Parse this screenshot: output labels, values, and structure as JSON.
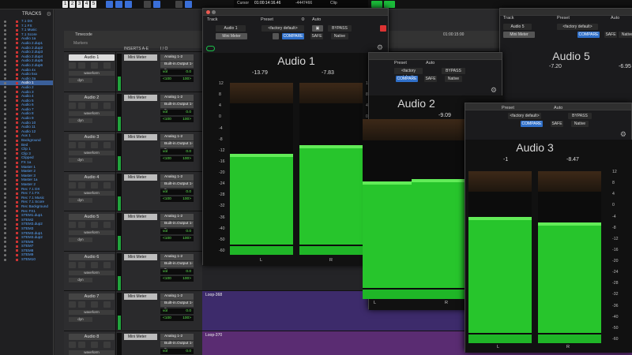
{
  "topbar": {
    "buttons": [
      "1",
      "2",
      "3",
      "4",
      "5"
    ],
    "counter": {
      "label": "Cursor",
      "time": "01:00:14:16.46",
      "sample": "-4447466",
      "clip_label": "Clip"
    }
  },
  "tracks_panel": {
    "title": "TRACKS",
    "menu_icon": "gear-icon",
    "items": [
      "7.1 DX",
      "7.1 FX",
      "7.1 Music",
      "7.1 Score",
      "Audio 1a",
      "Audio 2.dup1",
      "Audio 2.dup2",
      "Audio 2.dup3",
      "Audio 2.dup4",
      "Audio 2.dup5",
      "Audio 2.dup6",
      "Audio 4x",
      "Audio 5xx",
      "Audio 3a",
      "Audio 1",
      "Audio 2",
      "Audio 3",
      "Audio 4",
      "Audio 5",
      "Audio 6",
      "Audio 7",
      "Audio 8",
      "Audio 9",
      "Audio 10",
      "Audio 11",
      "Audio 12",
      "Aux 1",
      "Background",
      "Bed",
      "Clip 1",
      "Clip 3",
      "Clipped",
      "FX 1a",
      "Master 1",
      "Master 2",
      "Master 3",
      "Master 1a",
      "Master 2",
      "Rec 7.1 DX",
      "Rec 7.1 FX",
      "Rec 7.1 Music",
      "Rec 7.1 Score",
      "Rec Background",
      "Rec FX1",
      "STEM1.dup1",
      "STEM2",
      "STEM3.dup2",
      "STEM3",
      "STEM3.dup1",
      "STEM3.dup2",
      "STEM6",
      "STEM7",
      "STEM8",
      "STEM9",
      "STEM10"
    ],
    "selected": 14
  },
  "edit": {
    "ruler_label": "Timecode",
    "ruler_marker": "Markers",
    "ruler_time": "01:00:15:00",
    "columns": {
      "inserts": "INSERTS A-E",
      "io": "I / O"
    },
    "tracks": [
      {
        "name": "Audio 1",
        "insert": "Mini Meter",
        "input": "Analog 1-2",
        "output": "Built-in.Output 1-2",
        "vol": "0.0",
        "pan": "<100",
        "pan2": "100>",
        "view": "waveform",
        "dyn": "dyn"
      },
      {
        "name": "Audio 2",
        "insert": "Mini Meter",
        "input": "Analog 1-2",
        "output": "Built-in.Output 1-2",
        "vol": "0.0",
        "pan": "<100",
        "pan2": "100>",
        "view": "waveform",
        "dyn": "dyn"
      },
      {
        "name": "Audio 3",
        "insert": "Mini Meter",
        "input": "Analog 1-2",
        "output": "Built-in.Output 1-2",
        "vol": "0.0",
        "pan": "<100",
        "pan2": "100>",
        "view": "waveform",
        "dyn": "dyn"
      },
      {
        "name": "Audio 4",
        "insert": "Mini Meter",
        "input": "Analog 1-2",
        "output": "Built-in.Output 1-2",
        "vol": "0.0",
        "pan": "<100",
        "pan2": "100>",
        "view": "waveform",
        "dyn": "dyn"
      },
      {
        "name": "Audio 5",
        "insert": "Mini Meter",
        "input": "Analog 1-2",
        "output": "Built-in.Output 1-2",
        "vol": "0.0",
        "pan": "<100",
        "pan2": "100>",
        "view": "waveform",
        "dyn": "dyn"
      },
      {
        "name": "Audio 6",
        "insert": "Mini Meter",
        "input": "Analog 1-2",
        "output": "Built-in.Output 1-2",
        "vol": "0.0",
        "pan": "<100",
        "pan2": "100>",
        "view": "waveform",
        "dyn": "dyn"
      },
      {
        "name": "Audio 7",
        "insert": "Mini Meter",
        "input": "Analog 1-2",
        "output": "Built-in.Output 1-2",
        "vol": "0.0",
        "pan": "<100",
        "pan2": "100>",
        "view": "waveform",
        "dyn": "dyn"
      },
      {
        "name": "Audio 8",
        "insert": "Mini Meter",
        "input": "Analog 1-2",
        "output": "Built-in.Output 1-2",
        "vol": "0.0",
        "pan": "<100",
        "pan2": "100>",
        "view": "waveform",
        "dyn": "dyn"
      }
    ],
    "clip_labels": [
      "Loop-368",
      "Loop-370"
    ]
  },
  "plugins": [
    {
      "title": "Audio 1",
      "track_label": "Track",
      "track": "Audio 1",
      "preset_label": "Preset",
      "preset": "<factory default>",
      "auto_label": "Auto",
      "insert": "Mini Meter",
      "compare": "COMPARE",
      "safe": "SAFE",
      "native": "Native",
      "bypass": "BYPASS",
      "peak_l": "-13.79",
      "peak_r": "-7.83",
      "ch_l": "L",
      "ch_r": "R",
      "level_l": 0.62,
      "level_r": 0.68,
      "scale": [
        "12",
        "8",
        "4",
        "0",
        "-4",
        "-8",
        "-12",
        "-16",
        "-20",
        "-24",
        "-28",
        "-32",
        "-36",
        "-40",
        "-50",
        "-60"
      ]
    },
    {
      "title": "Audio 5",
      "track_label": "Track",
      "track": "Audio 5",
      "preset_label": "Preset",
      "preset": "<factory default>",
      "auto_label": "Auto",
      "insert": "Mini Meter",
      "compare": "COMPARE",
      "safe": "SAFE",
      "native": "Native",
      "bypass": "BYPASS",
      "peak_l": "-7.20",
      "peak_r": "-6.95"
    },
    {
      "title": "Audio 2",
      "track_label": "Track",
      "track": "Audio 2",
      "preset_label": "Preset",
      "preset": "<factory default>",
      "auto_label": "Auto",
      "compare": "COMPARE",
      "safe": "SAFE",
      "native": "Native",
      "bypass": "BYPASS",
      "peak_l": "",
      "peak_r": "-9.09",
      "ch_l": "L",
      "ch_r": "R",
      "scale": [
        "-24",
        "-28",
        "-32",
        "-36",
        "-40",
        "-50",
        "-60"
      ]
    },
    {
      "title": "Audio 3",
      "track_label": "Track",
      "track": "",
      "preset_label": "Preset",
      "preset": "<factory default>",
      "auto_label": "Auto",
      "compare": "COMPARE",
      "safe": "SAFE",
      "native": "Native",
      "bypass": "BYPASS",
      "peak_l": "-1",
      "peak_r": "-8.47",
      "ch_l": "L",
      "ch_r": "R",
      "scale": [
        "12",
        "8",
        "4",
        "0",
        "-4",
        "-8",
        "-12",
        "-16",
        "-20",
        "-24",
        "-28",
        "-32",
        "-36",
        "-40",
        "-50",
        "-60"
      ]
    }
  ]
}
